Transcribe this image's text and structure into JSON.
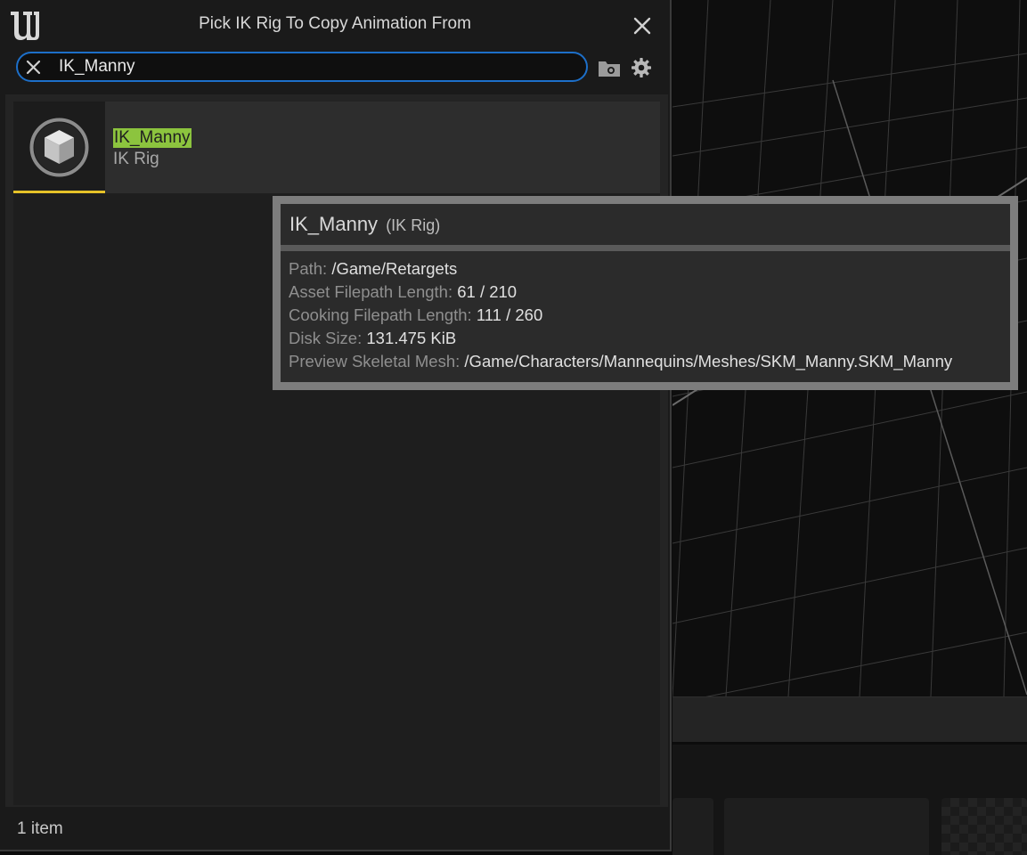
{
  "window": {
    "title": "Pick IK Rig To Copy Animation From"
  },
  "search": {
    "value": "IK_Manny",
    "placeholder": ""
  },
  "asset": {
    "name": "IK_Manny",
    "type": "IK Rig",
    "type_color": "#e6c228",
    "highlight_color": "#8cc43e"
  },
  "tooltip": {
    "title": "IK_Manny",
    "subtitle": "(IK Rig)",
    "rows": [
      {
        "label": "Path:",
        "value": "/Game/Retargets"
      },
      {
        "label": "Asset Filepath Length:",
        "value": "61 / 210"
      },
      {
        "label": "Cooking Filepath Length:",
        "value": "111 / 260"
      },
      {
        "label": "Disk Size:",
        "value": "131.475 KiB"
      },
      {
        "label": "Preview Skeletal Mesh:",
        "value": "/Game/Characters/Mannequins/Meshes/SKM_Manny.SKM_Manny"
      }
    ]
  },
  "footer": {
    "item_count": "1 item"
  },
  "icons": {
    "logo": "unreal-logo-icon",
    "close": "close-icon",
    "clear": "clear-search-icon",
    "folder": "folder-icon",
    "settings": "gear-icon",
    "asset": "cube-icon"
  },
  "colors": {
    "search_focus": "#1d6fc9"
  }
}
